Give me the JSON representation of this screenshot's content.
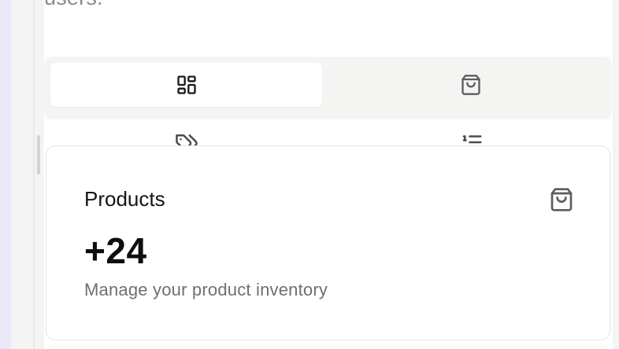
{
  "header": {
    "partial_text": "users."
  },
  "tabs": [
    {
      "icon": "dashboard-grid-icon",
      "active": true
    },
    {
      "icon": "shopping-bag-icon",
      "active": false
    }
  ],
  "tabs_row2": [
    {
      "icon": "tags-icon"
    },
    {
      "icon": "list-ordered-icon"
    }
  ],
  "card": {
    "title": "Products",
    "value": "+24",
    "description": "Manage your product inventory",
    "icon": "shopping-bag-icon"
  },
  "colors": {
    "tab_bar_bg": "#f4f4f3",
    "active_tab_bg": "#ffffff",
    "left_rail": "#ebe9f7"
  }
}
